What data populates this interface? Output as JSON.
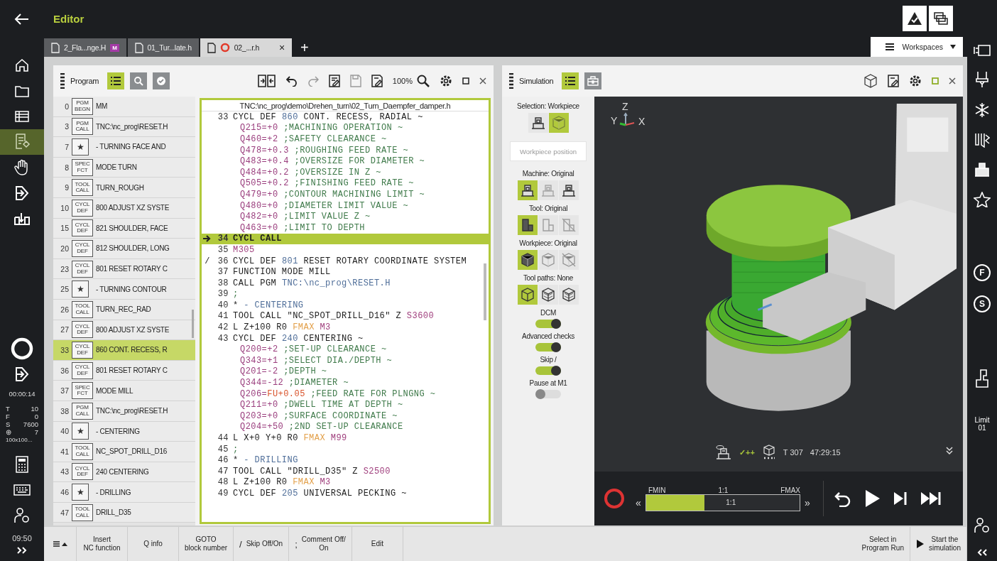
{
  "top_bar": {
    "title": "Editor"
  },
  "left_nav": {
    "items": [
      {
        "selected": false
      },
      {
        "selected": false
      },
      {
        "selected": false
      },
      {
        "selected": true
      },
      {
        "selected": false
      },
      {
        "selected": false
      },
      {
        "selected": false
      }
    ],
    "time_elapsed": "00:00:14",
    "status": [
      {
        "label": "T",
        "value": "10"
      },
      {
        "label": "F",
        "value": "0"
      },
      {
        "label": "S",
        "value": "7600"
      },
      {
        "label": "⊕",
        "value": "7"
      }
    ],
    "workpiece_size": "100x100...",
    "clock": "09:50"
  },
  "tabs": [
    {
      "label": "2_Fla...nge.H",
      "badge": "M",
      "running": false,
      "selected": false
    },
    {
      "label": "01_Tur...late.h",
      "running": false,
      "selected": false
    },
    {
      "label": "02_...r.h",
      "running": true,
      "close": "×",
      "selected": true
    }
  ],
  "new_tab": "+",
  "workspaces": "Workspaces",
  "program_panel": {
    "title": "Program",
    "view_buttons": [
      {
        "selected": true
      },
      {
        "selected": false
      },
      {
        "selected": false
      }
    ],
    "zoom": "100%",
    "blocks": [
      {
        "n": "0",
        "tag": "PGM BEGN",
        "label": "MM",
        "selected": false
      },
      {
        "n": "3",
        "tag": "PGM CALL",
        "label": "TNC:\\nc_prog\\RESET.H",
        "selected": false
      },
      {
        "n": "7",
        "tag": "★",
        "label": "- TURNING FACE AND",
        "selected": false
      },
      {
        "n": "8",
        "tag": "SPEC FCT",
        "label": "MODE TURN",
        "selected": false
      },
      {
        "n": "9",
        "tag": "TOOL CALL",
        "label": "TURN_ROUGH",
        "selected": false
      },
      {
        "n": "10",
        "tag": "CYCL DEF",
        "label": "800 ADJUST XZ SYSTE",
        "selected": false
      },
      {
        "n": "15",
        "tag": "CYCL DEF",
        "label": "821 SHOULDER, FACE",
        "selected": false
      },
      {
        "n": "20",
        "tag": "CYCL DEF",
        "label": "812 SHOULDER, LONG",
        "selected": false
      },
      {
        "n": "23",
        "tag": "CYCL DEF",
        "label": "801 RESET ROTARY C",
        "selected": false
      },
      {
        "n": "25",
        "tag": "★",
        "label": "- TURNING CONTOUR",
        "selected": false
      },
      {
        "n": "26",
        "tag": "TOOL CALL",
        "label": "TURN_REC_RAD",
        "selected": false
      },
      {
        "n": "27",
        "tag": "CYCL DEF",
        "label": "800 ADJUST XZ SYSTE",
        "selected": false
      },
      {
        "n": "33",
        "tag": "CYCL DEF",
        "label": "860 CONT. RECESS, R",
        "selected": true
      },
      {
        "n": "36",
        "tag": "CYCL DEF",
        "label": "801 RESET ROTARY C",
        "selected": false
      },
      {
        "n": "37",
        "tag": "SPEC FCT",
        "label": "MODE MILL",
        "selected": false
      },
      {
        "n": "38",
        "tag": "PGM CALL",
        "label": "TNC:\\nc_prog\\RESET.H",
        "selected": false
      },
      {
        "n": "40",
        "tag": "★",
        "label": "- CENTERING",
        "selected": false
      },
      {
        "n": "41",
        "tag": "TOOL CALL",
        "label": "NC_SPOT_DRILL_D16",
        "selected": false
      },
      {
        "n": "43",
        "tag": "CYCL DEF",
        "label": "240 CENTERING",
        "selected": false
      },
      {
        "n": "46",
        "tag": "★",
        "label": "- DRILLING",
        "selected": false
      },
      {
        "n": "47",
        "tag": "TOOL CALL",
        "label": "DRILL_D35",
        "selected": false
      }
    ],
    "path": "TNC:\\nc_prog\\demo\\Drehen_turn\\02_Turn_Daempfer_damper.h",
    "code": [
      {
        "n": "33",
        "current": false,
        "parts": [
          {
            "t": "CYCL DEF ",
            "kind": "k"
          },
          {
            "t": "860",
            "kind": "n"
          },
          {
            "t": " CONT. RECESS, RADIAL ~",
            "kind": "k"
          }
        ]
      },
      {
        "current": false,
        "parts": [
          {
            "t": "Q215=+0",
            "kind": "q"
          },
          {
            "t": " ;MACHINING OPERATION ~",
            "kind": "c"
          }
        ]
      },
      {
        "current": false,
        "parts": [
          {
            "t": "Q460=+2",
            "kind": "q"
          },
          {
            "t": " ;SAFETY CLEARANCE ~",
            "kind": "c"
          }
        ]
      },
      {
        "current": false,
        "parts": [
          {
            "t": "Q478=+0.3",
            "kind": "q"
          },
          {
            "t": " ;ROUGHING FEED RATE ~",
            "kind": "c"
          }
        ]
      },
      {
        "current": false,
        "parts": [
          {
            "t": "Q483=+0.4",
            "kind": "q"
          },
          {
            "t": " ;OVERSIZE FOR DIAMETER ~",
            "kind": "c"
          }
        ]
      },
      {
        "current": false,
        "parts": [
          {
            "t": "Q484=+0.2",
            "kind": "q"
          },
          {
            "t": " ;OVERSIZE IN Z ~",
            "kind": "c"
          }
        ]
      },
      {
        "current": false,
        "parts": [
          {
            "t": "Q505=+0.2",
            "kind": "q"
          },
          {
            "t": " ;FINISHING FEED RATE ~",
            "kind": "c"
          }
        ]
      },
      {
        "current": false,
        "parts": [
          {
            "t": "Q479=+0",
            "kind": "q"
          },
          {
            "t": " ;CONTOUR MACHINING LIMIT ~",
            "kind": "c"
          }
        ]
      },
      {
        "current": false,
        "parts": [
          {
            "t": "Q480=+0",
            "kind": "q"
          },
          {
            "t": " ;DIAMETER LIMIT VALUE ~",
            "kind": "c"
          }
        ]
      },
      {
        "current": false,
        "parts": [
          {
            "t": "Q482=+0",
            "kind": "q"
          },
          {
            "t": " ;LIMIT VALUE Z ~",
            "kind": "c"
          }
        ]
      },
      {
        "current": false,
        "parts": [
          {
            "t": "Q463=+0",
            "kind": "q"
          },
          {
            "t": " ;LIMIT TO DEPTH",
            "kind": "c"
          }
        ]
      },
      {
        "n": "34",
        "current": true,
        "parts": [
          {
            "t": "CYCL CALL",
            "kind": "k"
          }
        ]
      },
      {
        "n": "35",
        "current": false,
        "parts": [
          {
            "t": "M305",
            "kind": "m"
          }
        ]
      },
      {
        "n": "36",
        "skip": "/",
        "current": false,
        "parts": [
          {
            "t": "CYCL DEF ",
            "kind": "k"
          },
          {
            "t": "801",
            "kind": "n"
          },
          {
            "t": " RESET ROTARY COORDINATE SYSTEM",
            "kind": "k"
          }
        ]
      },
      {
        "n": "37",
        "current": false,
        "parts": [
          {
            "t": "FUNCTION MODE MILL",
            "kind": "k"
          }
        ]
      },
      {
        "n": "38",
        "current": false,
        "parts": [
          {
            "t": "CALL PGM ",
            "kind": "k"
          },
          {
            "t": "TNC:\\nc_prog\\RESET.H",
            "kind": "n"
          }
        ]
      },
      {
        "n": "39",
        "current": false,
        "parts": [
          {
            "t": ";",
            "kind": "c"
          }
        ]
      },
      {
        "n": "40",
        "current": false,
        "parts": [
          {
            "t": "* ",
            "kind": "k"
          },
          {
            "t": "- CENTERING",
            "kind": "n"
          }
        ]
      },
      {
        "n": "41",
        "current": false,
        "parts": [
          {
            "t": "TOOL CALL \"NC_SPOT_DRILL_D16\" Z ",
            "kind": "k"
          },
          {
            "t": "S3600",
            "kind": "m"
          }
        ]
      },
      {
        "n": "42",
        "current": false,
        "parts": [
          {
            "t": "L Z+100 R0 ",
            "kind": "k"
          },
          {
            "t": "FMAX",
            "kind": "f"
          },
          {
            "t": " M3",
            "kind": "m"
          }
        ]
      },
      {
        "n": "43",
        "current": false,
        "parts": [
          {
            "t": "CYCL DEF ",
            "kind": "k"
          },
          {
            "t": "240",
            "kind": "n"
          },
          {
            "t": " CENTERING ~",
            "kind": "k"
          }
        ]
      },
      {
        "current": false,
        "parts": [
          {
            "t": "Q200=+2",
            "kind": "q"
          },
          {
            "t": " ;SET-UP CLEARANCE ~",
            "kind": "c"
          }
        ]
      },
      {
        "current": false,
        "parts": [
          {
            "t": "Q343=+1",
            "kind": "q"
          },
          {
            "t": " ;SELECT DIA./DEPTH ~",
            "kind": "c"
          }
        ]
      },
      {
        "current": false,
        "parts": [
          {
            "t": "Q201=-2",
            "kind": "q"
          },
          {
            "t": " ;DEPTH ~",
            "kind": "c"
          }
        ]
      },
      {
        "current": false,
        "parts": [
          {
            "t": "Q344=-12",
            "kind": "q"
          },
          {
            "t": " ;DIAMETER ~",
            "kind": "c"
          }
        ]
      },
      {
        "current": false,
        "parts": [
          {
            "t": "Q206=",
            "kind": "q"
          },
          {
            "t": "FU+0.05",
            "kind": "r"
          },
          {
            "t": " ;FEED RATE FOR PLNGNG ~",
            "kind": "c"
          }
        ]
      },
      {
        "current": false,
        "parts": [
          {
            "t": "Q211=+0",
            "kind": "q"
          },
          {
            "t": " ;DWELL TIME AT DEPTH ~",
            "kind": "c"
          }
        ]
      },
      {
        "current": false,
        "parts": [
          {
            "t": "Q203=+0",
            "kind": "q"
          },
          {
            "t": " ;SURFACE COORDINATE ~",
            "kind": "c"
          }
        ]
      },
      {
        "current": false,
        "parts": [
          {
            "t": "Q204=+50",
            "kind": "q"
          },
          {
            "t": " ;2ND SET-UP CLEARANCE",
            "kind": "c"
          }
        ]
      },
      {
        "n": "44",
        "current": false,
        "parts": [
          {
            "t": "L X+0 Y+0 R0 ",
            "kind": "k"
          },
          {
            "t": "FMAX",
            "kind": "f"
          },
          {
            "t": " M99",
            "kind": "m"
          }
        ]
      },
      {
        "n": "45",
        "current": false,
        "parts": [
          {
            "t": ";",
            "kind": "c"
          }
        ]
      },
      {
        "n": "46",
        "current": false,
        "parts": [
          {
            "t": "* ",
            "kind": "k"
          },
          {
            "t": "- DRILLING",
            "kind": "n"
          }
        ]
      },
      {
        "n": "47",
        "current": false,
        "parts": [
          {
            "t": "TOOL CALL \"DRILL_D35\" Z ",
            "kind": "k"
          },
          {
            "t": "S2500",
            "kind": "m"
          }
        ]
      },
      {
        "n": "48",
        "current": false,
        "parts": [
          {
            "t": "L Z+100 R0 ",
            "kind": "k"
          },
          {
            "t": "FMAX",
            "kind": "f"
          },
          {
            "t": " M3",
            "kind": "m"
          }
        ]
      },
      {
        "n": "49",
        "current": false,
        "parts": [
          {
            "t": "CYCL DEF ",
            "kind": "k"
          },
          {
            "t": "205",
            "kind": "n"
          },
          {
            "t": " UNIVERSAL PECKING ~",
            "kind": "k"
          }
        ]
      }
    ]
  },
  "simulation": {
    "title": "Simulation",
    "view_buttons": [
      {
        "selected": true
      },
      {
        "selected": false
      }
    ],
    "options": [
      {
        "kind": "icons",
        "label": "Selection: Workpiece",
        "buttons": [
          {
            "kind": "machine",
            "selected": false
          },
          {
            "kind": "cube",
            "selected": true
          }
        ]
      },
      {
        "kind": "field",
        "placeholder": "Workpiece position"
      },
      {
        "kind": "icons",
        "label": "Machine: Original",
        "buttons": [
          {
            "kind": "machine",
            "selected": true
          },
          {
            "kind": "machine",
            "selected": false
          },
          {
            "kind": "machine",
            "selected": false
          }
        ]
      },
      {
        "kind": "icons",
        "label": "Tool: Original",
        "buttons": [
          {
            "kind": "tool",
            "selected": true
          },
          {
            "kind": "tool",
            "selected": false
          },
          {
            "kind": "tool",
            "selected": false
          }
        ]
      },
      {
        "kind": "icons",
        "label": "Workpiece: Original",
        "buttons": [
          {
            "kind": "cube",
            "selected": true
          },
          {
            "kind": "cube",
            "selected": false
          },
          {
            "kind": "cube",
            "selected": false
          }
        ]
      },
      {
        "kind": "icons",
        "label": "Tool paths: None",
        "buttons": [
          {
            "kind": "wire",
            "selected": true
          },
          {
            "kind": "wire",
            "selected": false
          },
          {
            "kind": "wire",
            "selected": false
          }
        ]
      },
      {
        "kind": "toggle",
        "label": "DCM",
        "on": true
      },
      {
        "kind": "toggle",
        "label": "Advanced checks",
        "on": true
      },
      {
        "kind": "toggle",
        "label": "Skip /",
        "on": true
      },
      {
        "kind": "toggle",
        "label": "Pause at M1",
        "on": false
      }
    ],
    "axes": {
      "z": "Z",
      "y": "Y",
      "x": "X"
    },
    "status": {
      "check": "✓++",
      "tool": "T 307",
      "time": "47:29:15"
    },
    "speed": {
      "min": "FMIN",
      "mid": "1:1",
      "max": "FMAX",
      "slower": "«",
      "faster": "»",
      "value": "1:1",
      "level": 0.38
    }
  },
  "right_nav": {
    "feed": "F",
    "spindle": "S",
    "limit": "Limit\n01"
  },
  "bottom_bar": {
    "left": [
      {
        "label": "Insert\nNC function"
      },
      {
        "label": "Q info"
      },
      {
        "label": "GOTO\nblock number"
      },
      {
        "prefix": "/",
        "label": "Skip Off/On"
      },
      {
        "prefix": ";",
        "label": "Comment Off/\nOn"
      },
      {
        "label": "Edit"
      }
    ],
    "right": [
      {
        "kind": "plain",
        "label": "Select in\nProgram Run"
      },
      {
        "kind": "start",
        "label": "Start the\nsimulation"
      }
    ]
  }
}
